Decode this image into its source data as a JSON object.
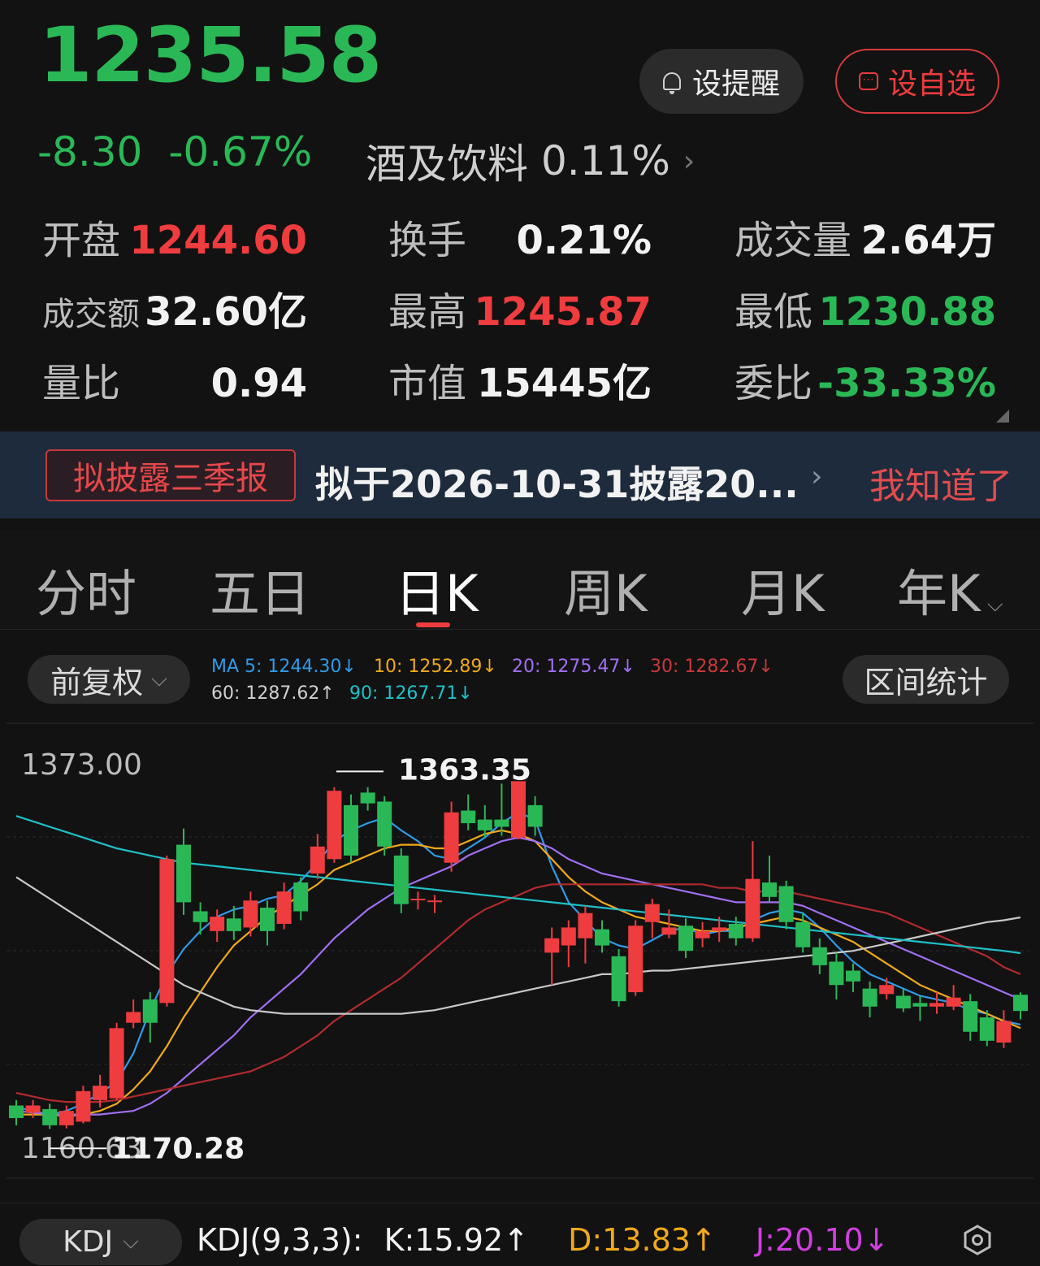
{
  "quote": {
    "price": "1235.58",
    "change": "-8.30",
    "change_pct": "-0.67%",
    "sector_name": "酒及饮料",
    "sector_pct": "0.11%",
    "alert_label": "设提醒",
    "watch_label": "设自选"
  },
  "stats": {
    "open_label": "开盘",
    "open_value": "1244.60",
    "turnover_rate_label": "换手",
    "turnover_rate_value": "0.21%",
    "volume_label": "成交量",
    "volume_value": "2.64万",
    "amount_label": "成交额",
    "amount_value": "32.60亿",
    "high_label": "最高",
    "high_value": "1245.87",
    "low_label": "最低",
    "low_value": "1230.88",
    "vol_ratio_label": "量比",
    "vol_ratio_value": "0.94",
    "mktcap_label": "市值",
    "mktcap_value": "15445亿",
    "bid_ratio_label": "委比",
    "bid_ratio_value": "-33.33%"
  },
  "notice": {
    "tag": "拟披露三季报",
    "text": "拟于2026-10-31披露20...",
    "dismiss": "我知道了"
  },
  "tabs": [
    "分时",
    "五日",
    "日K",
    "周K",
    "月K",
    "年K"
  ],
  "active_tab": "日K",
  "controls": {
    "adjust_label": "前复权",
    "range_stats_label": "区间统计"
  },
  "ma_legend": {
    "ma5": "MA 5: 1244.30↓",
    "ma10": "10: 1252.89↓",
    "ma20": "20: 1275.47↓",
    "ma30": "30: 1282.67↓",
    "ma60": "60: 1287.62↑",
    "ma90": "90: 1267.71↓"
  },
  "colors": {
    "up": "#ee3c3f",
    "down": "#2ab857",
    "ma5": "#2e9be8",
    "ma10": "#f0a91a",
    "ma20": "#a06ff2",
    "ma30": "#b22a2d",
    "ma60": "#c8c8c8",
    "ma90": "#1fc0c8"
  },
  "kdj": {
    "selector_label": "KDJ",
    "title": "KDJ(9,3,3):",
    "k": "K:15.92↑",
    "d": "D:13.83↑",
    "j": "J:20.10↓"
  },
  "chart_data": {
    "type": "candlestick",
    "axis_top_label": "1373.00",
    "axis_bottom_label": "1160.63",
    "ylim": [
      1160.63,
      1373.0
    ],
    "max_label": "1363.35",
    "min_label": "1170.28",
    "candles": [
      {
        "o": 1183,
        "c": 1176,
        "h": 1186,
        "l": 1172
      },
      {
        "o": 1179,
        "c": 1183,
        "h": 1186,
        "l": 1176
      },
      {
        "o": 1181,
        "c": 1172,
        "h": 1184,
        "l": 1170
      },
      {
        "o": 1172,
        "c": 1180,
        "h": 1183,
        "l": 1170.28
      },
      {
        "o": 1174,
        "c": 1191,
        "h": 1194,
        "l": 1173
      },
      {
        "o": 1186,
        "c": 1194,
        "h": 1200,
        "l": 1182
      },
      {
        "o": 1187,
        "c": 1226,
        "h": 1229,
        "l": 1186
      },
      {
        "o": 1229,
        "c": 1235,
        "h": 1242,
        "l": 1226
      },
      {
        "o": 1242,
        "c": 1229,
        "h": 1246,
        "l": 1218
      },
      {
        "o": 1240,
        "c": 1320,
        "h": 1322,
        "l": 1238
      },
      {
        "o": 1328,
        "c": 1296,
        "h": 1337,
        "l": 1289
      },
      {
        "o": 1291,
        "c": 1285,
        "h": 1296,
        "l": 1278
      },
      {
        "o": 1280,
        "c": 1288,
        "h": 1292,
        "l": 1274
      },
      {
        "o": 1287,
        "c": 1280,
        "h": 1294,
        "l": 1275
      },
      {
        "o": 1282,
        "c": 1297,
        "h": 1302,
        "l": 1277
      },
      {
        "o": 1293,
        "c": 1280,
        "h": 1297,
        "l": 1272
      },
      {
        "o": 1284,
        "c": 1302,
        "h": 1307,
        "l": 1281
      },
      {
        "o": 1307,
        "c": 1291,
        "h": 1310,
        "l": 1286
      },
      {
        "o": 1312,
        "c": 1327,
        "h": 1334,
        "l": 1309
      },
      {
        "o": 1320,
        "c": 1358,
        "h": 1360,
        "l": 1318
      },
      {
        "o": 1350,
        "c": 1322,
        "h": 1356,
        "l": 1318
      },
      {
        "o": 1357,
        "c": 1351,
        "h": 1360,
        "l": 1347
      },
      {
        "o": 1352,
        "c": 1327,
        "h": 1355,
        "l": 1322
      },
      {
        "o": 1322,
        "c": 1295,
        "h": 1326,
        "l": 1290
      },
      {
        "o": 1298,
        "c": 1298,
        "h": 1302,
        "l": 1292
      },
      {
        "o": 1297,
        "c": 1297,
        "h": 1300,
        "l": 1290
      },
      {
        "o": 1318,
        "c": 1346,
        "h": 1352,
        "l": 1313
      },
      {
        "o": 1347,
        "c": 1340,
        "h": 1356,
        "l": 1336
      },
      {
        "o": 1342,
        "c": 1336,
        "h": 1350,
        "l": 1332
      },
      {
        "o": 1342,
        "c": 1338,
        "h": 1362,
        "l": 1333
      },
      {
        "o": 1332,
        "c": 1363.35,
        "h": 1363.35,
        "l": 1331
      },
      {
        "o": 1350,
        "c": 1338,
        "h": 1355,
        "l": 1333
      },
      {
        "o": 1268,
        "c": 1276,
        "h": 1282,
        "l": 1250
      },
      {
        "o": 1272,
        "c": 1282,
        "h": 1286,
        "l": 1260
      },
      {
        "o": 1276,
        "c": 1290,
        "h": 1294,
        "l": 1262
      },
      {
        "o": 1281,
        "c": 1272,
        "h": 1286,
        "l": 1268
      },
      {
        "o": 1266,
        "c": 1241,
        "h": 1270,
        "l": 1238
      },
      {
        "o": 1246,
        "c": 1283,
        "h": 1286,
        "l": 1244
      },
      {
        "o": 1285,
        "c": 1295,
        "h": 1298,
        "l": 1276
      },
      {
        "o": 1278,
        "c": 1282,
        "h": 1292,
        "l": 1276
      },
      {
        "o": 1283,
        "c": 1269,
        "h": 1287,
        "l": 1265
      },
      {
        "o": 1276,
        "c": 1280,
        "h": 1285,
        "l": 1271
      },
      {
        "o": 1280,
        "c": 1282,
        "h": 1288,
        "l": 1274
      },
      {
        "o": 1284,
        "c": 1276,
        "h": 1288,
        "l": 1272
      },
      {
        "o": 1276,
        "c": 1309,
        "h": 1330,
        "l": 1274
      },
      {
        "o": 1307,
        "c": 1299,
        "h": 1322,
        "l": 1296
      },
      {
        "o": 1305,
        "c": 1285,
        "h": 1308,
        "l": 1281
      },
      {
        "o": 1285,
        "c": 1271,
        "h": 1290,
        "l": 1268
      },
      {
        "o": 1271,
        "c": 1261,
        "h": 1276,
        "l": 1256
      },
      {
        "o": 1263,
        "c": 1250,
        "h": 1268,
        "l": 1242
      },
      {
        "o": 1258,
        "c": 1252,
        "h": 1262,
        "l": 1246
      },
      {
        "o": 1248,
        "c": 1238,
        "h": 1252,
        "l": 1232
      },
      {
        "o": 1245,
        "c": 1250,
        "h": 1254,
        "l": 1242
      },
      {
        "o": 1244,
        "c": 1237,
        "h": 1248,
        "l": 1235
      },
      {
        "o": 1240,
        "c": 1238,
        "h": 1244,
        "l": 1230
      },
      {
        "o": 1238,
        "c": 1240,
        "h": 1246,
        "l": 1234
      },
      {
        "o": 1238,
        "c": 1243,
        "h": 1250,
        "l": 1236
      },
      {
        "o": 1241,
        "c": 1224,
        "h": 1245,
        "l": 1219
      },
      {
        "o": 1232,
        "c": 1219,
        "h": 1236,
        "l": 1216
      },
      {
        "o": 1218,
        "c": 1230,
        "h": 1236,
        "l": 1215
      },
      {
        "o": 1244.6,
        "c": 1235.58,
        "h": 1245.87,
        "l": 1230.88
      }
    ],
    "ma_lines": [
      {
        "name": "MA 5",
        "color": "#2e9be8",
        "values": [
          1182,
          1180,
          1178,
          1180,
          1184,
          1190,
          1196,
          1212,
          1236,
          1256,
          1270,
          1280,
          1288,
          1292,
          1294,
          1298,
          1300,
          1308,
          1318,
          1330,
          1336,
          1340,
          1343,
          1336,
          1330,
          1322,
          1320,
          1326,
          1332,
          1340,
          1346,
          1342,
          1316,
          1296,
          1286,
          1276,
          1272,
          1270,
          1275,
          1280,
          1282,
          1278,
          1280,
          1280,
          1286,
          1290,
          1292,
          1290,
          1282,
          1272,
          1263,
          1256,
          1252,
          1248,
          1244,
          1242,
          1240,
          1236,
          1234,
          1230,
          1228
        ]
      },
      {
        "name": "MA 10",
        "color": "#f0a91a",
        "values": [
          1178,
          1178,
          1178,
          1177,
          1178,
          1180,
          1184,
          1192,
          1202,
          1216,
          1232,
          1246,
          1260,
          1272,
          1280,
          1288,
          1294,
          1300,
          1306,
          1314,
          1318,
          1322,
          1326,
          1328,
          1328,
          1326,
          1326,
          1330,
          1334,
          1336,
          1334,
          1330,
          1320,
          1310,
          1302,
          1296,
          1292,
          1288,
          1286,
          1284,
          1282,
          1280,
          1280,
          1282,
          1284,
          1286,
          1288,
          1286,
          1282,
          1278,
          1274,
          1268,
          1262,
          1256,
          1250,
          1246,
          1242,
          1238,
          1234,
          1230,
          1226
        ]
      },
      {
        "name": "20",
        "color": "#a06ff2",
        "values": [
          1180,
          1179,
          1178,
          1178,
          1178,
          1178,
          1179,
          1180,
          1184,
          1190,
          1198,
          1206,
          1214,
          1222,
          1232,
          1240,
          1248,
          1256,
          1266,
          1276,
          1284,
          1292,
          1298,
          1304,
          1308,
          1312,
          1316,
          1322,
          1326,
          1330,
          1332,
          1330,
          1326,
          1320,
          1316,
          1312,
          1310,
          1308,
          1306,
          1304,
          1302,
          1300,
          1298,
          1296,
          1296,
          1296,
          1296,
          1294,
          1290,
          1286,
          1282,
          1278,
          1274,
          1270,
          1266,
          1262,
          1258,
          1254,
          1250,
          1246,
          1242
        ]
      },
      {
        "name": "30",
        "color": "#b22a2d",
        "values": [
          1190,
          1188,
          1186,
          1185,
          1185,
          1185,
          1186,
          1188,
          1190,
          1192,
          1194,
          1196,
          1198,
          1200,
          1202,
          1206,
          1210,
          1216,
          1222,
          1230,
          1236,
          1242,
          1248,
          1254,
          1262,
          1270,
          1278,
          1286,
          1292,
          1296,
          1300,
          1304,
          1306,
          1306,
          1306,
          1306,
          1306,
          1306,
          1306,
          1306,
          1306,
          1306,
          1304,
          1304,
          1302,
          1302,
          1302,
          1300,
          1298,
          1296,
          1294,
          1292,
          1290,
          1286,
          1282,
          1278,
          1274,
          1270,
          1266,
          1260,
          1256
        ]
      },
      {
        "name": "60",
        "color": "#c8c8c8",
        "values": [
          1310,
          1304,
          1298,
          1292,
          1286,
          1280,
          1274,
          1268,
          1262,
          1256,
          1250,
          1246,
          1242,
          1238,
          1236,
          1235,
          1234,
          1234,
          1234,
          1234,
          1234,
          1234,
          1234,
          1234,
          1235,
          1236,
          1238,
          1240,
          1242,
          1244,
          1246,
          1248,
          1250,
          1252,
          1254,
          1256,
          1256,
          1257,
          1258,
          1258,
          1259,
          1260,
          1261,
          1262,
          1263,
          1264,
          1265,
          1266,
          1267,
          1268,
          1269,
          1271,
          1273,
          1275,
          1277,
          1279,
          1281,
          1283,
          1285,
          1286,
          1287.62
        ]
      },
      {
        "name": "90",
        "color": "#1fc0c8",
        "values": [
          1344,
          1341,
          1338,
          1335,
          1332,
          1329,
          1326,
          1324,
          1322,
          1320,
          1318,
          1317,
          1316,
          1315,
          1314,
          1313,
          1312,
          1311,
          1310,
          1309,
          1308,
          1307,
          1306,
          1305,
          1304,
          1303,
          1302,
          1301,
          1300,
          1299,
          1298,
          1297,
          1296,
          1295,
          1294,
          1293,
          1292,
          1291,
          1290,
          1289,
          1288,
          1287,
          1286,
          1285,
          1284,
          1283,
          1282,
          1281,
          1280,
          1279,
          1278,
          1277,
          1276,
          1275,
          1274,
          1273,
          1272,
          1271,
          1270,
          1269,
          1267.71
        ]
      }
    ]
  }
}
